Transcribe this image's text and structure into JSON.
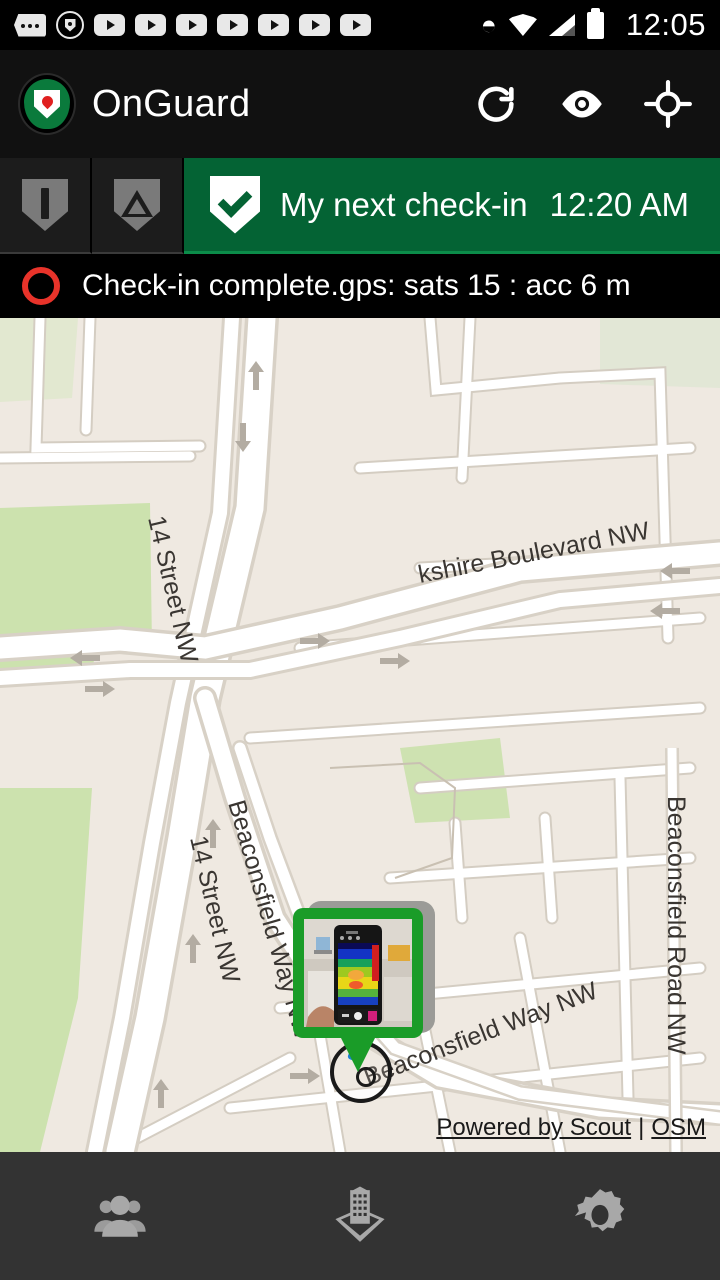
{
  "status_bar": {
    "icons": [
      "sms-icon",
      "onguard-shield-icon",
      "play-icon",
      "play-icon",
      "play-icon",
      "play-icon",
      "play-icon",
      "play-icon",
      "play-icon"
    ],
    "bluetooth_icon": "bluetooth-icon",
    "wifi_icon": "wifi-icon",
    "signal_icon": "cell-signal-icon",
    "battery_icon": "battery-icon",
    "time": "12:05"
  },
  "app_bar": {
    "logo_icon": "onguard-logo-icon",
    "title": "OnGuard",
    "actions": [
      {
        "name": "refresh-icon",
        "label": "Refresh"
      },
      {
        "name": "eye-icon",
        "label": "Visibility"
      },
      {
        "name": "crosshair-icon",
        "label": "Center on location"
      }
    ]
  },
  "status_row": {
    "panic_button": {
      "icon": "shield-exclamation-icon",
      "label": "Panic"
    },
    "alert_button": {
      "icon": "shield-warning-icon",
      "label": "Alert"
    },
    "banner": {
      "icon": "shield-check-icon",
      "label": "My next check-in",
      "time": "12:20 AM",
      "color": "#046334"
    }
  },
  "gps_row": {
    "icon": "record-circle-icon",
    "text": "Check-in complete.gps: sats 15 : acc 6 m",
    "icon_color": "#e8332a"
  },
  "map": {
    "street_labels": [
      "14 Street NW",
      "kshire Boulevard NW",
      "Beaconsfield Way NW",
      "14 Street NW",
      "Beaconsfield Way NW",
      "Beaconsfield Road NW"
    ],
    "marker": {
      "name": "photo-check-in-marker",
      "thumbnail_alt": "thermal camera phone photo"
    },
    "attribution": {
      "powered": "Powered by Scout",
      "separator": "|",
      "osm": "OSM"
    }
  },
  "bottom_nav": {
    "items": [
      {
        "name": "nav-people-icon",
        "label": "People"
      },
      {
        "name": "nav-site-icon",
        "label": "Sites"
      },
      {
        "name": "nav-settings-icon",
        "label": "Settings"
      }
    ]
  }
}
